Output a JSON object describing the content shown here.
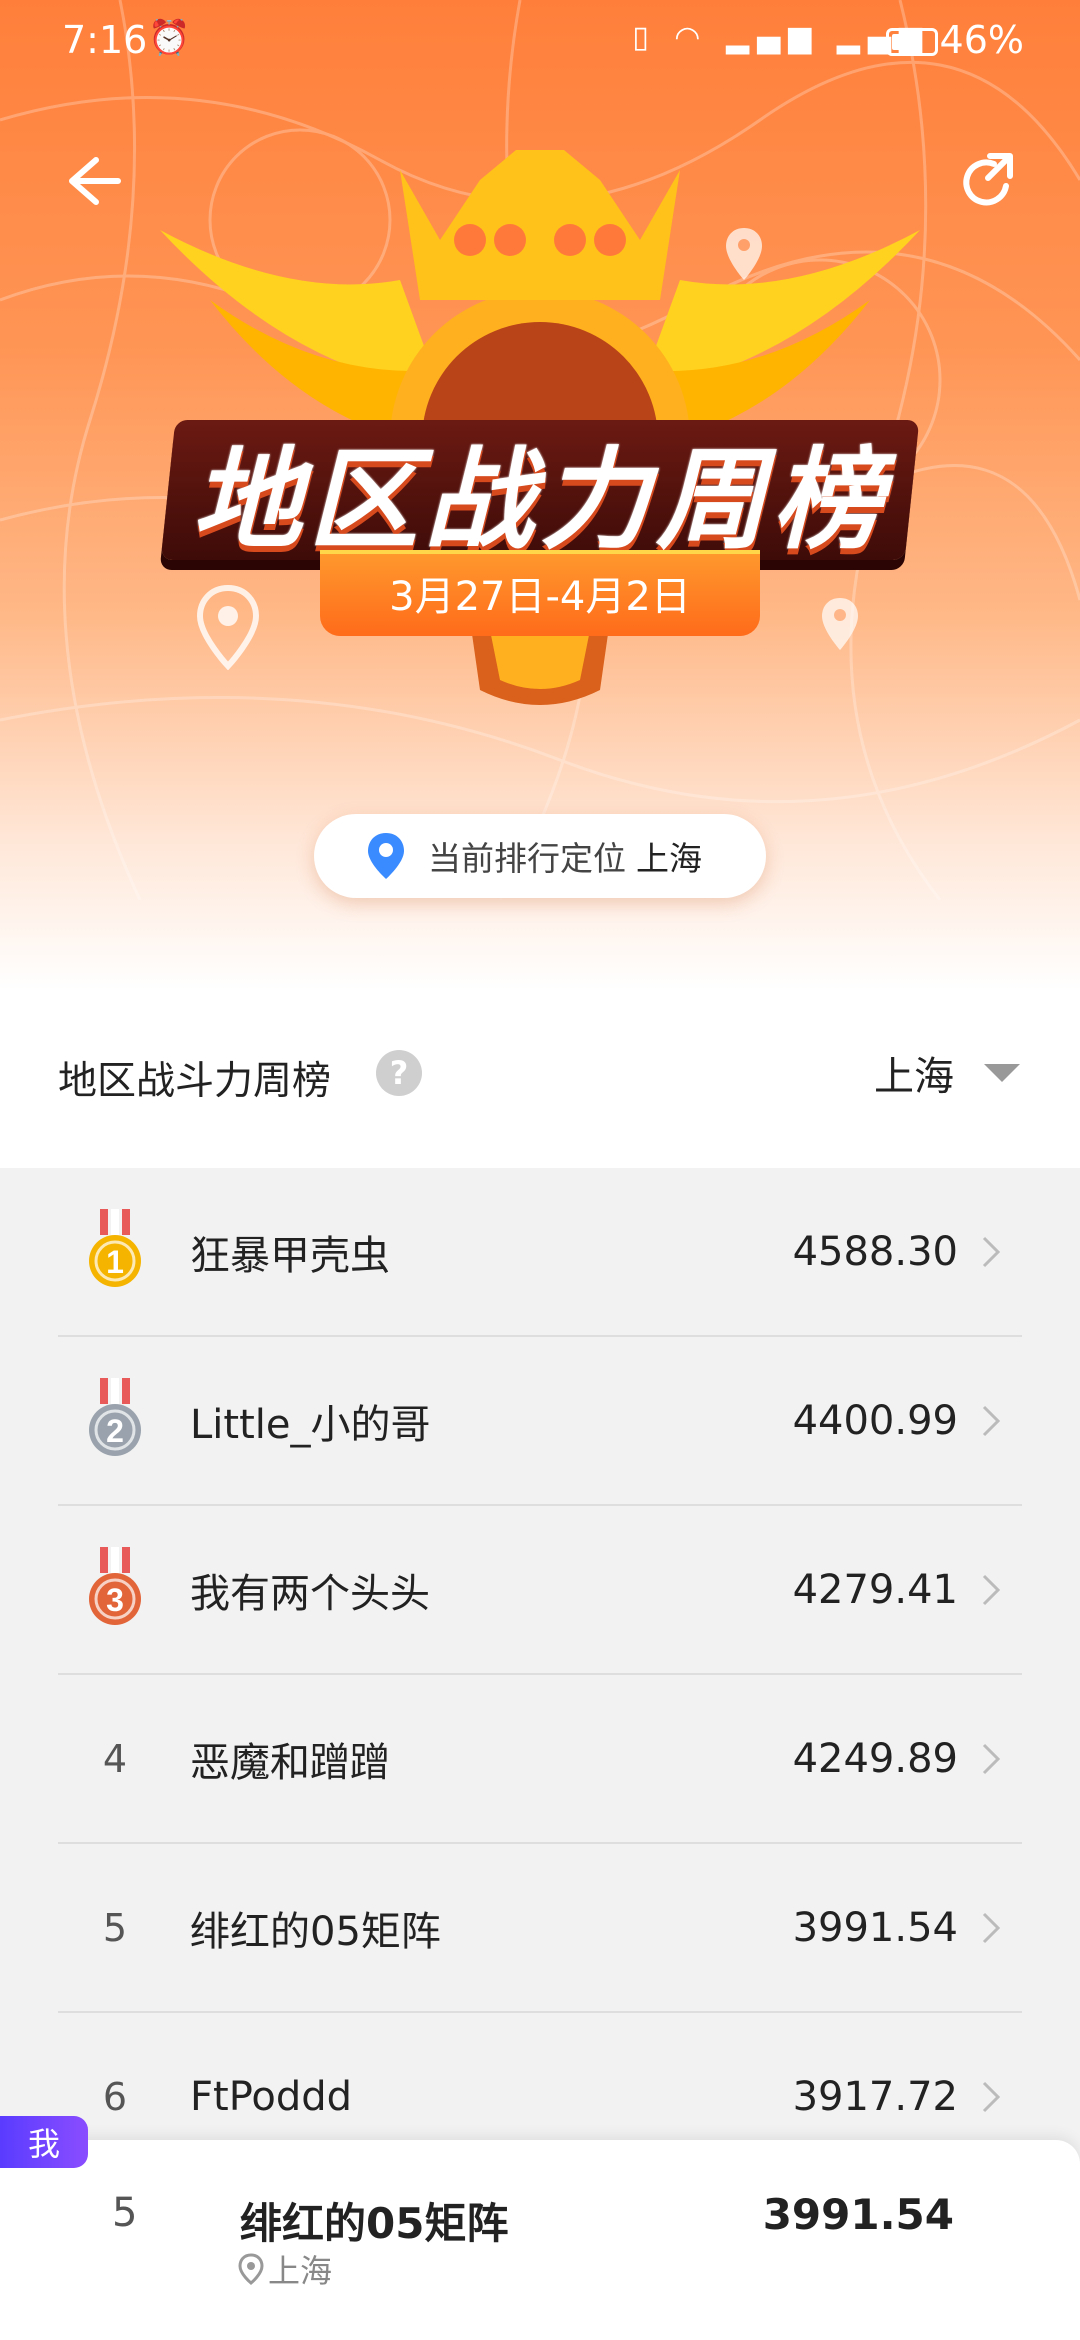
{
  "status_bar": {
    "time": "7:16",
    "left_icons": [
      "alarm-icon",
      "bluetooth-battery-icon"
    ],
    "right_icons": [
      "vibrate-icon",
      "wifi-icon",
      "5g-signal-icon",
      "4g-signal-icon",
      "battery-icon"
    ],
    "battery_level": 0.46,
    "battery_percent": "46%"
  },
  "header": {
    "title": "地区战力周榜",
    "date_range": "3月27日-4月2日",
    "location_label": "当前排行定位",
    "location_city": "上海"
  },
  "section": {
    "title": "地区战斗力周榜",
    "help_symbol": "?",
    "region": "上海"
  },
  "rankings": [
    {
      "rank": "1",
      "name": "狂暴甲壳虫",
      "score": "4588.30",
      "medal": "gold"
    },
    {
      "rank": "2",
      "name": "Little_小的哥",
      "score": "4400.99",
      "medal": "silver"
    },
    {
      "rank": "3",
      "name": "我有两个头头",
      "score": "4279.41",
      "medal": "bronze"
    },
    {
      "rank": "4",
      "name": "恶魔和蹭蹭",
      "score": "4249.89"
    },
    {
      "rank": "5",
      "name": "绯红的05矩阵",
      "score": "3991.54"
    },
    {
      "rank": "6",
      "name": "FtPoddd",
      "score": "3917.72"
    }
  ],
  "me": {
    "tag": "我",
    "rank": "5",
    "name": "绯红的05矩阵",
    "city": "上海",
    "score": "3991.54"
  },
  "colors": {
    "hero_orange": "#ff7f3a",
    "banner_dark": "#4a0e0a",
    "gold": "#f5b400",
    "silver": "#9aa3ad",
    "bronze": "#e2653a",
    "me_tag": "#6a45ff"
  }
}
